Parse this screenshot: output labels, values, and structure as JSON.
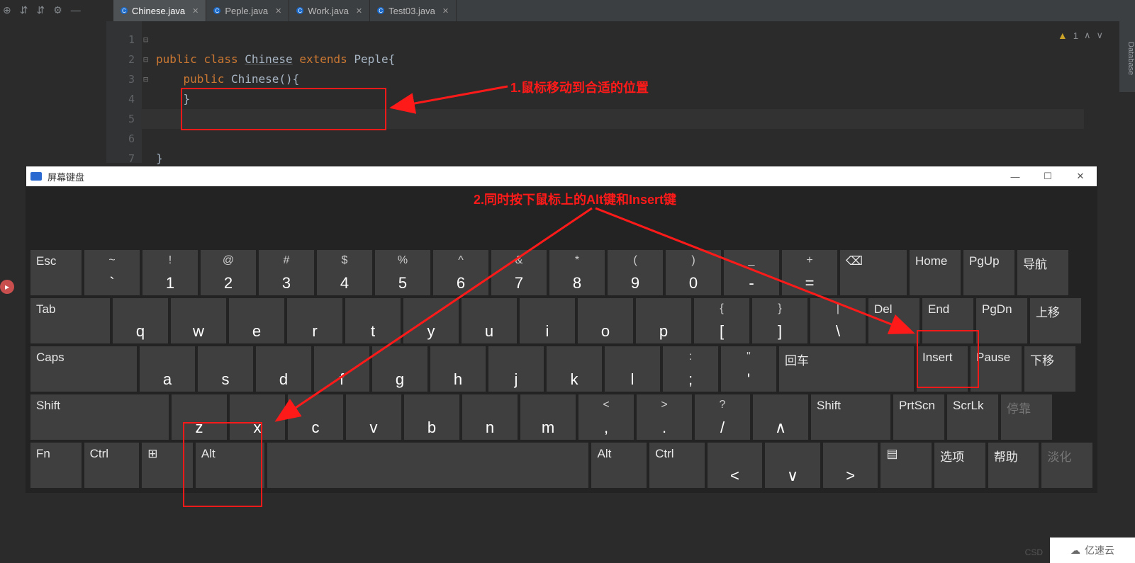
{
  "toolbar_icons": [
    "⊕",
    "⇵",
    "⇵",
    "⚙",
    "—"
  ],
  "tabs": [
    {
      "label": "Chinese.java",
      "active": true
    },
    {
      "label": "Peple.java",
      "active": false
    },
    {
      "label": "Work.java",
      "active": false
    },
    {
      "label": "Test03.java",
      "active": false
    }
  ],
  "gutter": [
    "1",
    "2",
    "3",
    "4",
    "5",
    "6",
    "7"
  ],
  "code": {
    "l1_kw1": "public",
    "l1_kw2": "class",
    "l1_name": "Chinese",
    "l1_kw3": "extends",
    "l1_super": "Peple",
    "l1_b": "{",
    "l2_kw": "public",
    "l2_name": "Chinese",
    "l2_p": "(){",
    "l3": "}",
    "l6": "}"
  },
  "status": {
    "warn": "▲",
    "count": "1",
    "up": "∧",
    "down": "∨"
  },
  "sidebar_db": "Database",
  "ann": {
    "t1": "1.鼠标移动到合适的位置",
    "t2": "2.同时按下鼠标上的Alt键和Insert键"
  },
  "osk": {
    "title": "屏幕键盘",
    "win": [
      "—",
      "☐",
      "✕"
    ],
    "row1": [
      {
        "lbl": "Esc"
      },
      {
        "t": "~",
        "b": "`"
      },
      {
        "t": "!",
        "b": "1"
      },
      {
        "t": "@",
        "b": "2"
      },
      {
        "t": "#",
        "b": "3"
      },
      {
        "t": "$",
        "b": "4"
      },
      {
        "t": "%",
        "b": "5"
      },
      {
        "t": "^",
        "b": "6"
      },
      {
        "t": "&",
        "b": "7"
      },
      {
        "t": "*",
        "b": "8"
      },
      {
        "t": "(",
        "b": "9"
      },
      {
        "t": ")",
        "b": "0"
      },
      {
        "t": "_",
        "b": "-"
      },
      {
        "t": "+",
        "b": "="
      },
      {
        "lbl": "⌫"
      },
      {
        "lbl": "Home"
      },
      {
        "lbl": "PgUp"
      },
      {
        "lbl": "导航"
      }
    ],
    "row2": [
      {
        "lbl": "Tab"
      },
      {
        "b": "q"
      },
      {
        "b": "w"
      },
      {
        "b": "e"
      },
      {
        "b": "r"
      },
      {
        "b": "t"
      },
      {
        "b": "y"
      },
      {
        "b": "u"
      },
      {
        "b": "i"
      },
      {
        "b": "o"
      },
      {
        "b": "p"
      },
      {
        "t": "{",
        "b": "["
      },
      {
        "t": "}",
        "b": "]"
      },
      {
        "t": "|",
        "b": "\\"
      },
      {
        "lbl": "Del"
      },
      {
        "lbl": "End"
      },
      {
        "lbl": "PgDn"
      },
      {
        "lbl": "上移"
      }
    ],
    "row3": [
      {
        "lbl": "Caps"
      },
      {
        "b": "a"
      },
      {
        "b": "s"
      },
      {
        "b": "d"
      },
      {
        "b": "f"
      },
      {
        "b": "g"
      },
      {
        "b": "h"
      },
      {
        "b": "j"
      },
      {
        "b": "k"
      },
      {
        "b": "l"
      },
      {
        "t": ":",
        "b": ";"
      },
      {
        "t": "\"",
        "b": "'"
      },
      {
        "lbl": "回车"
      },
      {
        "lbl": "Insert"
      },
      {
        "lbl": "Pause"
      },
      {
        "lbl": "下移"
      }
    ],
    "row4": [
      {
        "lbl": "Shift"
      },
      {
        "b": "z"
      },
      {
        "b": "x"
      },
      {
        "b": "c"
      },
      {
        "b": "v"
      },
      {
        "b": "b"
      },
      {
        "b": "n"
      },
      {
        "b": "m"
      },
      {
        "t": "<",
        "b": ","
      },
      {
        "t": ">",
        "b": "."
      },
      {
        "t": "?",
        "b": "/"
      },
      {
        "b": "∧"
      },
      {
        "lbl": "Shift"
      },
      {
        "lbl": "PrtScn"
      },
      {
        "lbl": "ScrLk"
      },
      {
        "lbl": "停靠",
        "dim": true
      }
    ],
    "row5": [
      {
        "lbl": "Fn"
      },
      {
        "lbl": "Ctrl"
      },
      {
        "lbl": "⊞"
      },
      {
        "lbl": "Alt"
      },
      {
        "lbl": ""
      },
      {
        "lbl": "Alt"
      },
      {
        "lbl": "Ctrl"
      },
      {
        "b": "<"
      },
      {
        "b": "∨"
      },
      {
        "b": ">"
      },
      {
        "lbl": "▤"
      },
      {
        "lbl": "选项"
      },
      {
        "lbl": "帮助"
      },
      {
        "lbl": "淡化",
        "dim": true
      }
    ]
  },
  "watermark": {
    "txt": "亿速云"
  },
  "csdn": "CSD"
}
